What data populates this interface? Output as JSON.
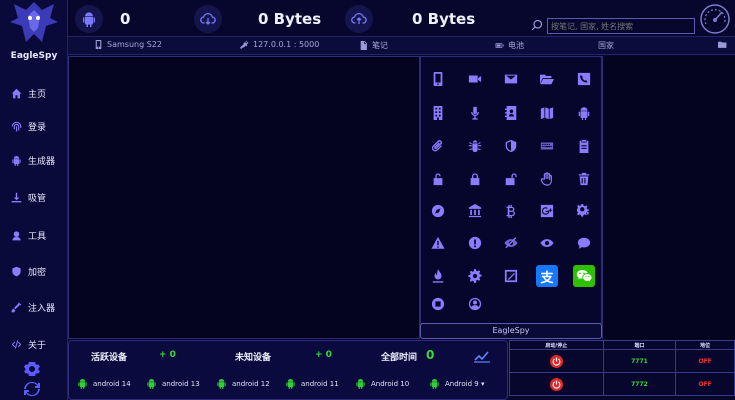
{
  "app": {
    "brand": "EagleSpy"
  },
  "topbar": {
    "devices_count": "0",
    "download_bytes": "0 Bytes",
    "upload_bytes": "0 Bytes",
    "search_placeholder": "按笔记, 国家, 姓名搜索"
  },
  "device_info": {
    "model": "Samsung S22",
    "address": "127.0.0.1 : 5000",
    "notes": "笔记",
    "battery": "电池",
    "country": "国家"
  },
  "sidebar": {
    "items": [
      {
        "label": "主页",
        "icon": "home-icon"
      },
      {
        "label": "登录",
        "icon": "fingerprint-icon"
      },
      {
        "label": "生成器",
        "icon": "android-icon"
      },
      {
        "label": "吸管",
        "icon": "download-icon"
      },
      {
        "label": "工具",
        "icon": "tools-icon"
      },
      {
        "label": "加密",
        "icon": "shield-icon"
      },
      {
        "label": "注入器",
        "icon": "syringe-icon"
      },
      {
        "label": "关于",
        "icon": "code-icon"
      }
    ]
  },
  "icon_grid": {
    "rows": [
      [
        "phone-icon",
        "video-icon",
        "mail-icon",
        "folder-open-icon",
        "phone-call-icon"
      ],
      [
        "building-icon",
        "mic-icon",
        "contacts-icon",
        "map-icon",
        "android-icon"
      ],
      [
        "paperclip-icon",
        "bug-icon",
        "shield-icon",
        "keyboard-icon",
        "clipboard-icon"
      ],
      [
        "unlock-icon",
        "lock-icon",
        "lock-open-icon",
        "hand-icon",
        "trash-icon"
      ],
      [
        "compass-icon",
        "bank-icon",
        "bitcoin-icon",
        "google-plus-icon",
        "cogs-icon"
      ],
      [
        "warning-icon",
        "alert-icon",
        "eye-slash-icon",
        "eye-icon",
        "chat-icon"
      ],
      [
        "fire-icon",
        "gear-icon",
        "screenshot-icon",
        "alipay-icon",
        "wechat-icon"
      ],
      [
        "stop-icon",
        "user-circle-icon"
      ]
    ],
    "alipay_glyph": "支",
    "footer_label": "EagleSpy"
  },
  "stats": {
    "active_label": "活跃设备",
    "active_value": "+ 0",
    "unknown_label": "未知设备",
    "unknown_value": "+ 0",
    "total_label": "全部时间",
    "total_value": "0",
    "android_versions": [
      {
        "label": "android 14"
      },
      {
        "label": "android 13"
      },
      {
        "label": "android 12"
      },
      {
        "label": "android 11"
      },
      {
        "label": "Android 10"
      },
      {
        "label": "Android 9 ▾"
      }
    ]
  },
  "ports": {
    "headers": [
      "启动/停止",
      "端口",
      "地位"
    ],
    "rows": [
      {
        "port": "7771",
        "state": "OFF"
      },
      {
        "port": "7772",
        "state": "OFF"
      }
    ]
  },
  "colors": {
    "accent": "#8a7cff",
    "green": "#33dd33",
    "red": "#e02828",
    "alipay": "#1677ff",
    "wechat": "#2dc100"
  }
}
